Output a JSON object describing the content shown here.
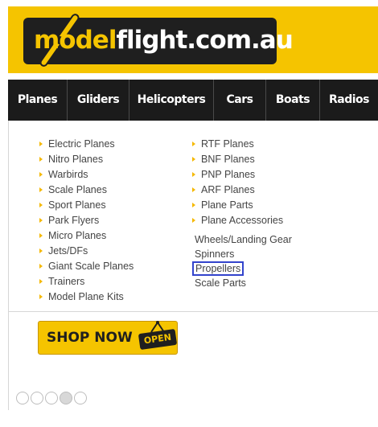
{
  "logo": {
    "text_model": "model",
    "text_rest": "flight.com.au"
  },
  "nav": {
    "items": [
      "Planes",
      "Gliders",
      "Helicopters",
      "Cars",
      "Boats",
      "Radios"
    ]
  },
  "menu": {
    "left": [
      "Electric Planes",
      "Nitro Planes",
      "Warbirds",
      "Scale Planes",
      "Sport Planes",
      "Park Flyers",
      "Micro Planes",
      "Jets/DFs",
      "Giant Scale Planes",
      "Trainers",
      "Model Plane Kits"
    ],
    "right": [
      "RTF Planes",
      "BNF Planes",
      "PNP Planes",
      "ARF Planes",
      "Plane Parts",
      "Plane Accessories"
    ],
    "sub": [
      "Wheels/Landing Gear",
      "Spinners",
      "Propellers",
      "Scale Parts"
    ]
  },
  "banner": {
    "shop_label": "SHOP NOW",
    "open_label": "OPEN"
  },
  "colors": {
    "brand_yellow": "#f5c400",
    "nav_dark": "#1b1b1b",
    "highlight_blue": "#3344cc"
  }
}
